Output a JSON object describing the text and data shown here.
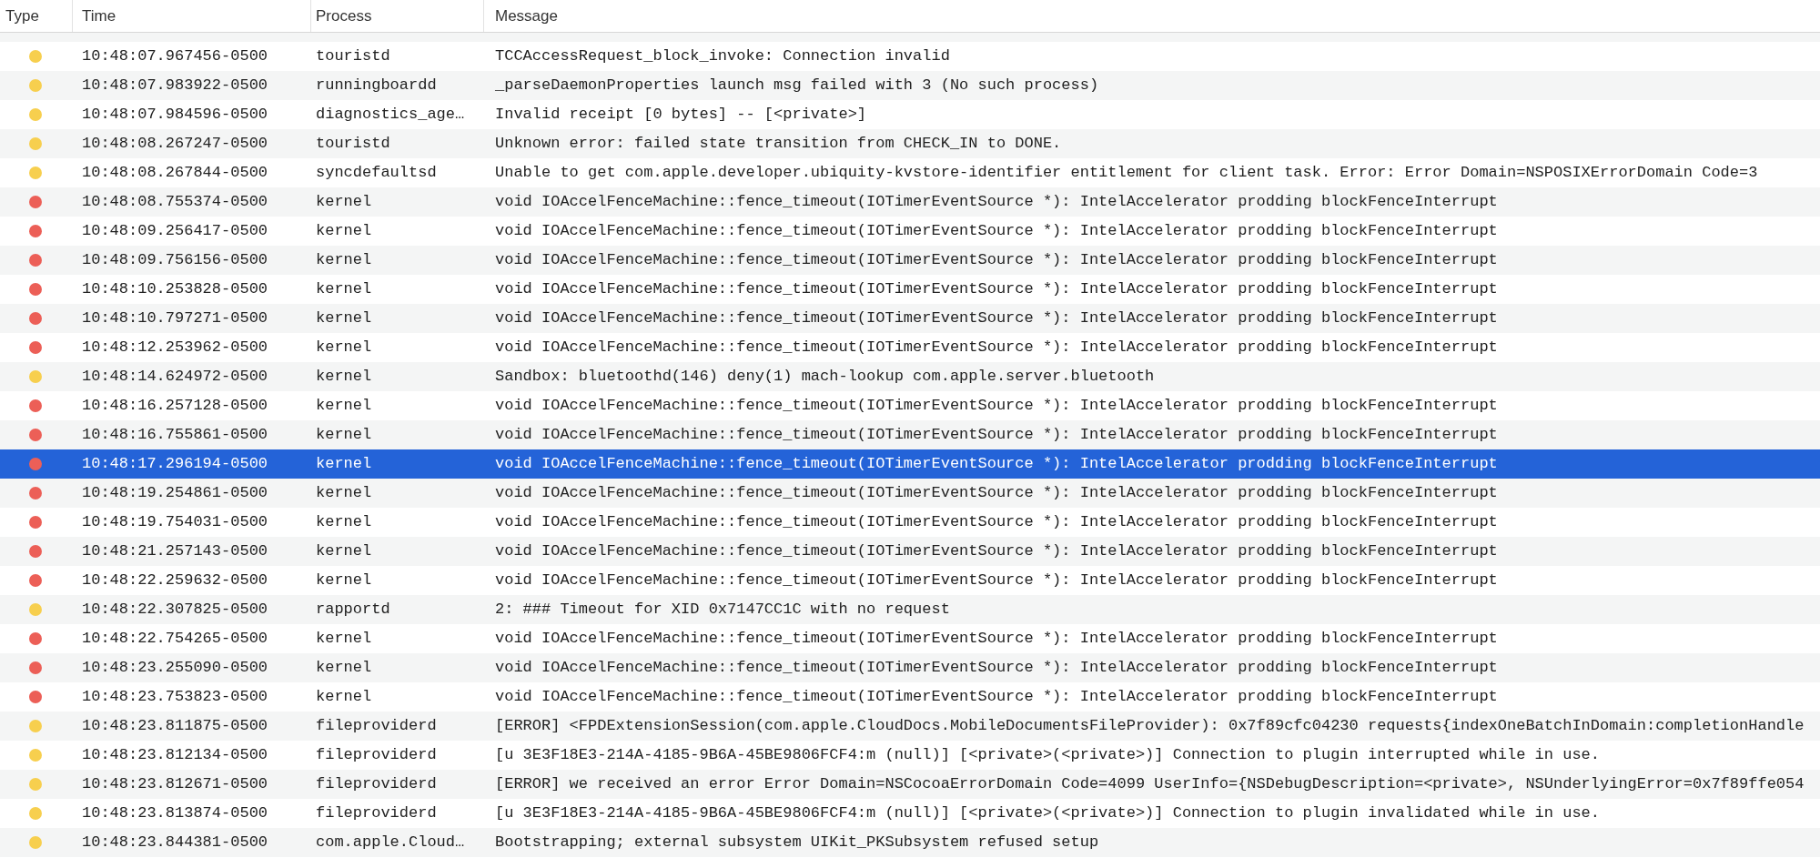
{
  "table": {
    "columns": [
      "Type",
      "Time",
      "Process",
      "Message"
    ],
    "rows": [
      {
        "color": "#f7cf4e",
        "time": "10:48:07.967456-0500",
        "process": "touristd",
        "message": "TCCAccessRequest_block_invoke: Connection invalid",
        "selected": false
      },
      {
        "color": "#f7cf4e",
        "time": "10:48:07.983922-0500",
        "process": "runningboardd",
        "message": "_parseDaemonProperties launch msg failed with 3 (No such process)",
        "selected": false
      },
      {
        "color": "#f7cf4e",
        "time": "10:48:07.984596-0500",
        "process": "diagnostics_age…",
        "message": "Invalid receipt [0 bytes] -- [<private>]",
        "selected": false
      },
      {
        "color": "#f7cf4e",
        "time": "10:48:08.267247-0500",
        "process": "touristd",
        "message": "Unknown error: failed state transition from CHECK_IN to DONE.",
        "selected": false
      },
      {
        "color": "#f7cf4e",
        "time": "10:48:08.267844-0500",
        "process": "syncdefaultsd",
        "message": "Unable to get com.apple.developer.ubiquity-kvstore-identifier entitlement for client task. Error: Error Domain=NSPOSIXErrorDomain Code=3",
        "selected": false
      },
      {
        "color": "#ec5f57",
        "time": "10:48:08.755374-0500",
        "process": "kernel",
        "message": "void IOAccelFenceMachine::fence_timeout(IOTimerEventSource *): IntelAccelerator prodding blockFenceInterrupt",
        "selected": false
      },
      {
        "color": "#ec5f57",
        "time": "10:48:09.256417-0500",
        "process": "kernel",
        "message": "void IOAccelFenceMachine::fence_timeout(IOTimerEventSource *): IntelAccelerator prodding blockFenceInterrupt",
        "selected": false
      },
      {
        "color": "#ec5f57",
        "time": "10:48:09.756156-0500",
        "process": "kernel",
        "message": "void IOAccelFenceMachine::fence_timeout(IOTimerEventSource *): IntelAccelerator prodding blockFenceInterrupt",
        "selected": false
      },
      {
        "color": "#ec5f57",
        "time": "10:48:10.253828-0500",
        "process": "kernel",
        "message": "void IOAccelFenceMachine::fence_timeout(IOTimerEventSource *): IntelAccelerator prodding blockFenceInterrupt",
        "selected": false
      },
      {
        "color": "#ec5f57",
        "time": "10:48:10.797271-0500",
        "process": "kernel",
        "message": "void IOAccelFenceMachine::fence_timeout(IOTimerEventSource *): IntelAccelerator prodding blockFenceInterrupt",
        "selected": false
      },
      {
        "color": "#ec5f57",
        "time": "10:48:12.253962-0500",
        "process": "kernel",
        "message": "void IOAccelFenceMachine::fence_timeout(IOTimerEventSource *): IntelAccelerator prodding blockFenceInterrupt",
        "selected": false
      },
      {
        "color": "#f7cf4e",
        "time": "10:48:14.624972-0500",
        "process": "kernel",
        "message": "Sandbox: bluetoothd(146) deny(1) mach-lookup com.apple.server.bluetooth",
        "selected": false
      },
      {
        "color": "#ec5f57",
        "time": "10:48:16.257128-0500",
        "process": "kernel",
        "message": "void IOAccelFenceMachine::fence_timeout(IOTimerEventSource *): IntelAccelerator prodding blockFenceInterrupt",
        "selected": false
      },
      {
        "color": "#ec5f57",
        "time": "10:48:16.755861-0500",
        "process": "kernel",
        "message": "void IOAccelFenceMachine::fence_timeout(IOTimerEventSource *): IntelAccelerator prodding blockFenceInterrupt",
        "selected": false
      },
      {
        "color": "#ec5f57",
        "time": "10:48:17.296194-0500",
        "process": "kernel",
        "message": "void IOAccelFenceMachine::fence_timeout(IOTimerEventSource *): IntelAccelerator prodding blockFenceInterrupt",
        "selected": true
      },
      {
        "color": "#ec5f57",
        "time": "10:48:19.254861-0500",
        "process": "kernel",
        "message": "void IOAccelFenceMachine::fence_timeout(IOTimerEventSource *): IntelAccelerator prodding blockFenceInterrupt",
        "selected": false
      },
      {
        "color": "#ec5f57",
        "time": "10:48:19.754031-0500",
        "process": "kernel",
        "message": "void IOAccelFenceMachine::fence_timeout(IOTimerEventSource *): IntelAccelerator prodding blockFenceInterrupt",
        "selected": false
      },
      {
        "color": "#ec5f57",
        "time": "10:48:21.257143-0500",
        "process": "kernel",
        "message": "void IOAccelFenceMachine::fence_timeout(IOTimerEventSource *): IntelAccelerator prodding blockFenceInterrupt",
        "selected": false
      },
      {
        "color": "#ec5f57",
        "time": "10:48:22.259632-0500",
        "process": "kernel",
        "message": "void IOAccelFenceMachine::fence_timeout(IOTimerEventSource *): IntelAccelerator prodding blockFenceInterrupt",
        "selected": false
      },
      {
        "color": "#f7cf4e",
        "time": "10:48:22.307825-0500",
        "process": "rapportd",
        "message": "2: ### Timeout for XID 0x7147CC1C with no request",
        "selected": false
      },
      {
        "color": "#ec5f57",
        "time": "10:48:22.754265-0500",
        "process": "kernel",
        "message": "void IOAccelFenceMachine::fence_timeout(IOTimerEventSource *): IntelAccelerator prodding blockFenceInterrupt",
        "selected": false
      },
      {
        "color": "#ec5f57",
        "time": "10:48:23.255090-0500",
        "process": "kernel",
        "message": "void IOAccelFenceMachine::fence_timeout(IOTimerEventSource *): IntelAccelerator prodding blockFenceInterrupt",
        "selected": false
      },
      {
        "color": "#ec5f57",
        "time": "10:48:23.753823-0500",
        "process": "kernel",
        "message": "void IOAccelFenceMachine::fence_timeout(IOTimerEventSource *): IntelAccelerator prodding blockFenceInterrupt",
        "selected": false
      },
      {
        "color": "#f7cf4e",
        "time": "10:48:23.811875-0500",
        "process": "fileproviderd",
        "message": "[ERROR] <FPDExtensionSession(com.apple.CloudDocs.MobileDocumentsFileProvider): 0x7f89cfc04230 requests{indexOneBatchInDomain:completionHandle",
        "selected": false
      },
      {
        "color": "#f7cf4e",
        "time": "10:48:23.812134-0500",
        "process": "fileproviderd",
        "message": "[u 3E3F18E3-214A-4185-9B6A-45BE9806FCF4:m (null)] [<private>(<private>)] Connection to plugin interrupted while in use.",
        "selected": false
      },
      {
        "color": "#f7cf4e",
        "time": "10:48:23.812671-0500",
        "process": "fileproviderd",
        "message": "[ERROR] we received an error Error Domain=NSCocoaErrorDomain Code=4099 UserInfo={NSDebugDescription=<private>, NSUnderlyingError=0x7f89ffe054",
        "selected": false
      },
      {
        "color": "#f7cf4e",
        "time": "10:48:23.813874-0500",
        "process": "fileproviderd",
        "message": "[u 3E3F18E3-214A-4185-9B6A-45BE9806FCF4:m (null)] [<private>(<private>)] Connection to plugin invalidated while in use.",
        "selected": false
      },
      {
        "color": "#f7cf4e",
        "time": "10:48:23.844381-0500",
        "process": "com.apple.Cloud…",
        "message": "Bootstrapping; external subsystem UIKit_PKSubsystem refused setup",
        "selected": false
      }
    ]
  }
}
